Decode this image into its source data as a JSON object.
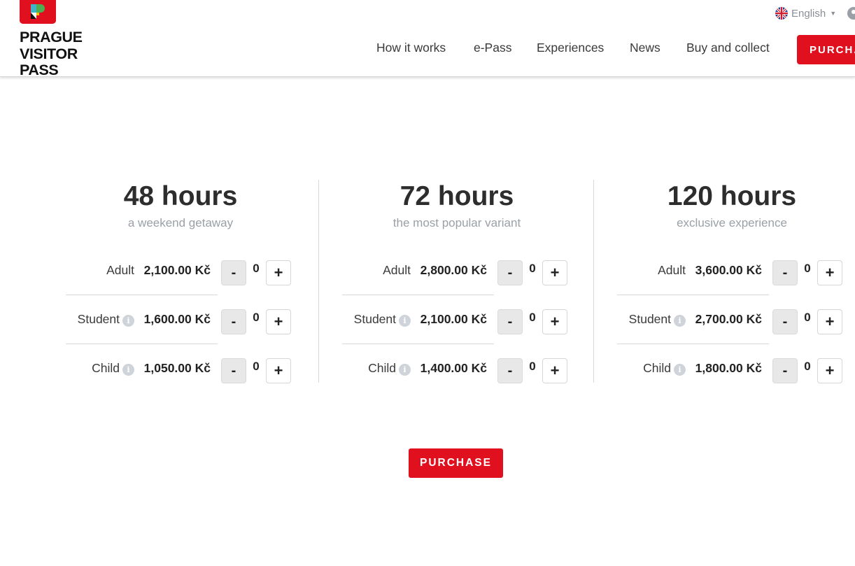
{
  "brand": {
    "logo_lines": [
      "PRAGUE",
      "VISITOR",
      "PASS"
    ],
    "colors": {
      "accent": "#e0101e",
      "mark_blue": "#3db4c8",
      "mark_green": "#4caf50",
      "mark_yellow": "#f4c20d"
    }
  },
  "header": {
    "language": "English",
    "language_icon": "uk-flag-icon",
    "user_icon": "user-icon",
    "nav": [
      "How it works",
      "e-Pass",
      "Experiences",
      "News",
      "Buy and collect"
    ],
    "purchase_label": "PURCHASE"
  },
  "passes": [
    {
      "title": "48 hours",
      "subtitle": "a weekend getaway",
      "rows": [
        {
          "label": "Adult",
          "price": "2,100.00 Kč",
          "qty": "0",
          "info": false
        },
        {
          "label": "Student",
          "price": "1,600.00 Kč",
          "qty": "0",
          "info": true
        },
        {
          "label": "Child",
          "price": "1,050.00 Kč",
          "qty": "0",
          "info": true
        }
      ]
    },
    {
      "title": "72 hours",
      "subtitle": "the most popular variant",
      "rows": [
        {
          "label": "Adult",
          "price": "2,800.00 Kč",
          "qty": "0",
          "info": false
        },
        {
          "label": "Student",
          "price": "2,100.00 Kč",
          "qty": "0",
          "info": true
        },
        {
          "label": "Child",
          "price": "1,400.00 Kč",
          "qty": "0",
          "info": true
        }
      ]
    },
    {
      "title": "120 hours",
      "subtitle": "exclusive experience",
      "rows": [
        {
          "label": "Adult",
          "price": "3,600.00 Kč",
          "qty": "0",
          "info": false
        },
        {
          "label": "Student",
          "price": "2,700.00 Kč",
          "qty": "0",
          "info": true
        },
        {
          "label": "Child",
          "price": "1,800.00 Kč",
          "qty": "0",
          "info": true
        }
      ]
    }
  ],
  "stepper": {
    "minus": "-",
    "plus": "+"
  },
  "info_glyph": "i",
  "purchase_button": "PURCHASE"
}
